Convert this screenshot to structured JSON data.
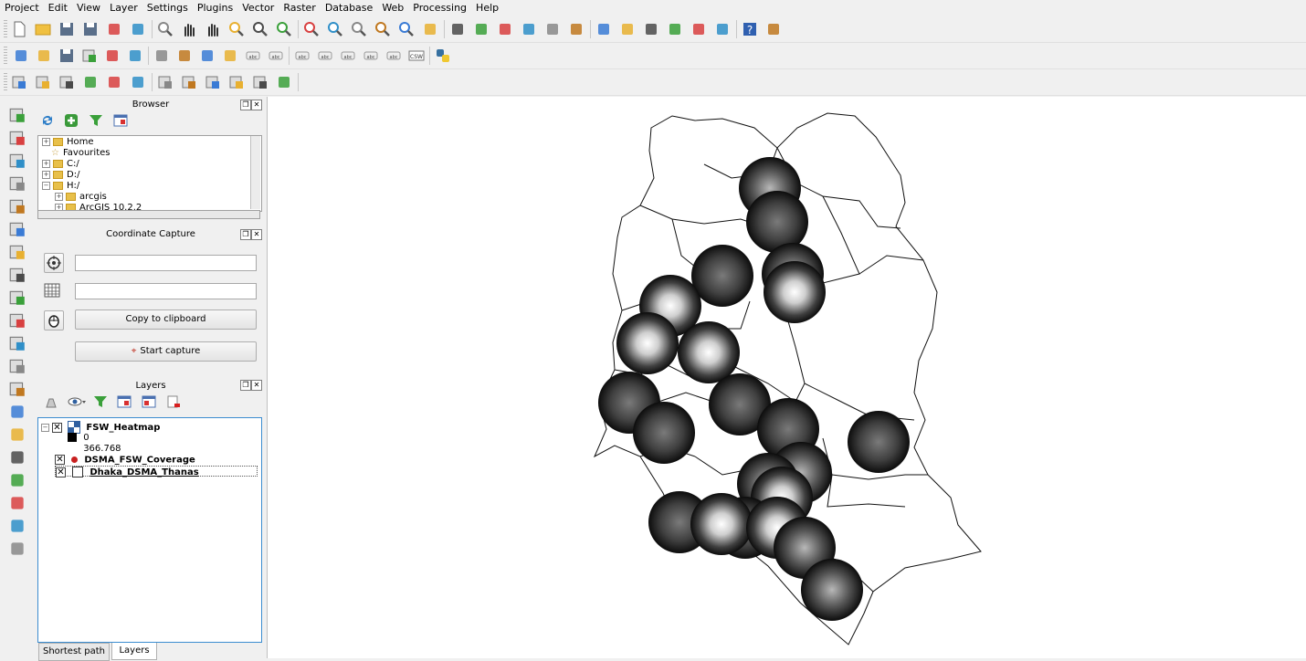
{
  "menu": [
    "Project",
    "Edit",
    "View",
    "Layer",
    "Settings",
    "Plugins",
    "Vector",
    "Raster",
    "Database",
    "Web",
    "Processing",
    "Help"
  ],
  "toolbar_icons": {
    "row1": [
      "new-project-icon",
      "open-project-icon",
      "save-project-icon",
      "save-as-icon",
      "new-print-composer-icon",
      "composer-manager-icon",
      "touch-zoom-icon",
      "pan-icon",
      "pan-to-selection-icon",
      "zoom-in-icon",
      "zoom-out-icon",
      "zoom-native-icon",
      "zoom-full-icon",
      "zoom-to-selection-icon",
      "zoom-to-layer-icon",
      "zoom-last-icon",
      "zoom-next-icon",
      "refresh-icon",
      "identify-icon",
      "action-icon",
      "select-features-icon",
      "deselect-icon",
      "field-calculator-icon",
      "attribute-table-icon",
      "statistics-icon",
      "measure-icon",
      "map-tips-icon",
      "new-bookmark-icon",
      "show-bookmarks-icon",
      "text-annotation-icon",
      "help-icon",
      "whats-this-icon"
    ],
    "row2": [
      "current-edits-icon",
      "toggle-editing-icon",
      "save-edits-icon",
      "add-feature-icon",
      "move-feature-icon",
      "node-tool-icon",
      "delete-selected-icon",
      "cut-features-icon",
      "copy-features-icon",
      "paste-features-icon",
      "label-icon",
      "pin-labels-icon",
      "highlight-pinned-icon",
      "move-label-icon",
      "rotate-label-icon",
      "change-label-icon",
      "show-hide-labels-icon",
      "csw-icon",
      "python-console-icon"
    ],
    "row3": [
      "add-vector-layer-icon",
      "add-raster-layer-icon",
      "add-postgis-layer-icon",
      "new-shapefile-icon",
      "new-spatialite-icon",
      "new-gpx-icon",
      "add-wfs-icon",
      "add-wcs-icon",
      "add-delimited-text-icon",
      "add-mssql-icon",
      "add-oracle-icon",
      "database-icon"
    ]
  },
  "left_toolbar_icons": [
    "add-vector-layer-icon",
    "add-raster-layer-icon",
    "add-postgis-layer-icon",
    "add-spatialite-icon",
    "add-mssql-icon",
    "add-oracle-icon",
    "add-wms-icon",
    "add-wcs-icon",
    "add-wfs-icon",
    "add-wms-wmts-icon",
    "add-delimited-text-icon",
    "create-layer-icon",
    "add-virtual-layer-icon",
    "coordinate-capture-icon",
    "georeferencer-icon",
    "shortest-path-icon",
    "topology-checker-icon",
    "raster-terrain-icon",
    "heatmap-icon",
    "metasearch-icon"
  ],
  "browser": {
    "title": "Browser",
    "items": [
      {
        "label": "Home",
        "expand": "⊞",
        "indent": 0
      },
      {
        "label": "Favourites",
        "expand": "",
        "indent": 0
      },
      {
        "label": "C:/",
        "expand": "⊞",
        "indent": 0
      },
      {
        "label": "D:/",
        "expand": "⊞",
        "indent": 0
      },
      {
        "label": "H:/",
        "expand": "⊟",
        "indent": 0
      },
      {
        "label": "arcgis",
        "expand": "⊞",
        "indent": 1
      },
      {
        "label": "ArcGIS 10.2.2",
        "expand": "⊞",
        "indent": 1
      }
    ]
  },
  "coordinate_capture": {
    "title": "Coordinate Capture",
    "field1_value": "",
    "field2_value": "",
    "copy_button": "Copy to clipboard",
    "start_button": "Start capture"
  },
  "layers": {
    "title": "Layers",
    "items": [
      {
        "name": "FSW_Heatmap",
        "checked": "✕"
      },
      {
        "name": "DSMA_FSW_Coverage",
        "checked": "✕"
      },
      {
        "name": "Dhaka_DSMA_Thanas",
        "checked": "✕"
      }
    ],
    "legend_min": "0",
    "legend_max": "366.768"
  },
  "tabs": [
    "Shortest path",
    "Layers"
  ],
  "colors": {
    "accent": "#3c8dd0",
    "heat_low": "#1a1a1a",
    "heat_high": "#ffffff",
    "coverage_point": "#c82020"
  }
}
